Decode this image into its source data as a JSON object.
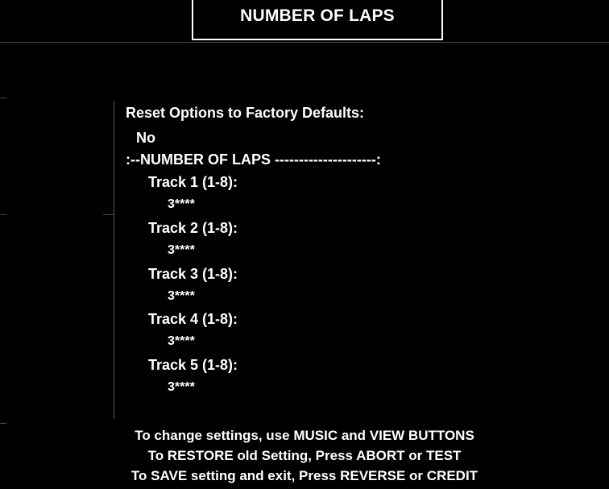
{
  "screen": {
    "title": "NUMBER OF LAPS"
  },
  "menu": {
    "reset_label": "Reset Options to Factory Defaults:",
    "reset_value": "No",
    "section_header": ":--NUMBER OF LAPS ---------------------:",
    "tracks": [
      {
        "label": "Track 1 (1-8):",
        "value": "3****"
      },
      {
        "label": "Track 2 (1-8):",
        "value": "3****"
      },
      {
        "label": "Track 3 (1-8):",
        "value": "3****"
      },
      {
        "label": "Track 4 (1-8):",
        "value": "3****"
      },
      {
        "label": "Track 5 (1-8):",
        "value": "3****"
      }
    ]
  },
  "footer": {
    "line1": "To change settings, use MUSIC and VIEW BUTTONS",
    "line2": "To RESTORE old Setting, Press ABORT or TEST",
    "line3": "To SAVE setting and exit, Press REVERSE or CREDIT"
  }
}
